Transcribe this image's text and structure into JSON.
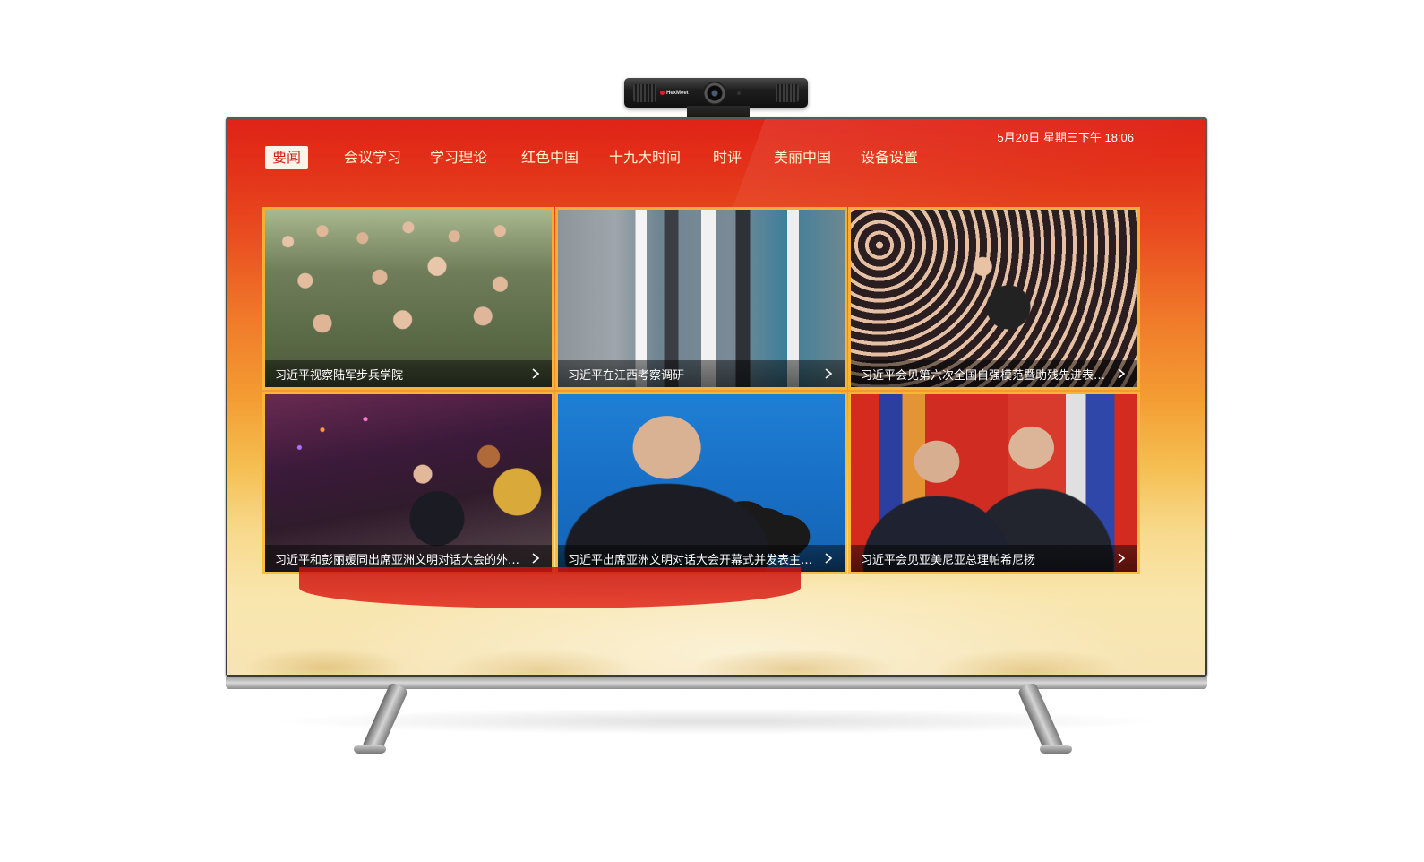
{
  "camera": {
    "brand": "HexMeet"
  },
  "status_bar": {
    "datetime": "5月20日  星期三下午  18:06"
  },
  "nav": {
    "active_index": 0,
    "items": [
      {
        "label": "要闻"
      },
      {
        "label": "会议学习"
      },
      {
        "label": "学习理论"
      },
      {
        "label": "红色中国"
      },
      {
        "label": "十九大时间"
      },
      {
        "label": "时评"
      },
      {
        "label": "美丽中国"
      },
      {
        "label": "设备设置"
      }
    ]
  },
  "news": [
    {
      "title": "习近平视察陆军步兵学院",
      "image": "soldiers-group-photo"
    },
    {
      "title": "习近平在江西考察调研",
      "image": "factory-visit-photo"
    },
    {
      "title": "习近平会见第六次全国自强模范暨助残先进表彰...",
      "image": "crowd-meeting-photo"
    },
    {
      "title": "习近平和彭丽媛同出席亚洲文明对话大会的外方...",
      "image": "gala-event-photo"
    },
    {
      "title": "习近平出席亚洲文明对话大会开幕式并发表主旨...",
      "image": "speech-podium-photo"
    },
    {
      "title": "习近平会见亚美尼亚总理帕希尼扬",
      "image": "handshake-flags-photo"
    }
  ],
  "colors": {
    "accent_red": "#d41e18",
    "nav_text": "#fff4cf",
    "card_border": "#f7b836"
  }
}
